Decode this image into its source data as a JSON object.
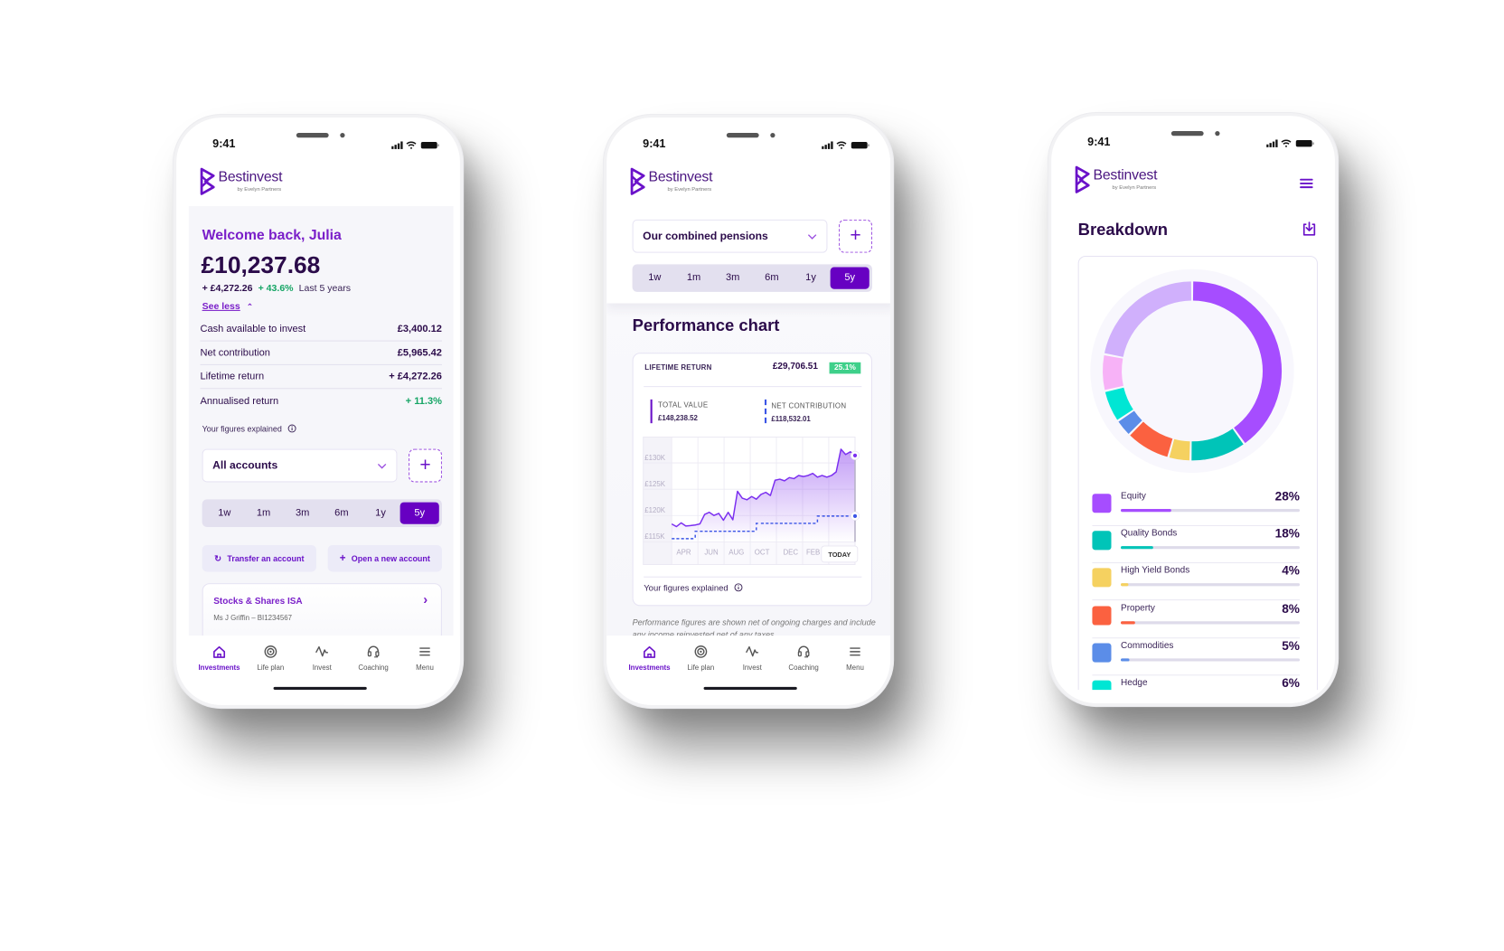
{
  "status": {
    "time": "9:41"
  },
  "brand": {
    "name": "Bestinvest",
    "tagline": "by Evelyn Partners"
  },
  "colors": {
    "brand_purple": "#6a12c9",
    "selected_period": "#6700c2",
    "text_dark": "#2b0b4a",
    "positive": "#16a565",
    "total_value_line": "#7b2ff0",
    "net_contribution_line": "#3b55e6"
  },
  "periods": [
    "1w",
    "1m",
    "3m",
    "6m",
    "1y",
    "5y"
  ],
  "selected_period": "5y",
  "nav": [
    {
      "label": "Investments",
      "icon": "home-icon",
      "active": true
    },
    {
      "label": "Life plan",
      "icon": "target-icon",
      "active": false
    },
    {
      "label": "Invest",
      "icon": "pulse-icon",
      "active": false
    },
    {
      "label": "Coaching",
      "icon": "headset-icon",
      "active": false
    },
    {
      "label": "Menu",
      "icon": "menu-icon",
      "active": false
    }
  ],
  "overview": {
    "welcome": "Welcome back, Julia",
    "total": "£10,237.68",
    "change_amount": "+ £4,272.26",
    "change_pct": "+ 43.6%",
    "change_period": "Last 5 years",
    "see_less": "See less",
    "rows": [
      {
        "label": "Cash available to invest",
        "value": "£3,400.12",
        "positive": false
      },
      {
        "label": "Net contribution",
        "value": "£5,965.42",
        "positive": false
      },
      {
        "label": "Lifetime return",
        "value": "+ £4,272.26",
        "positive": false
      },
      {
        "label": "Annualised return",
        "value": "+ 11.3%",
        "positive": true
      }
    ],
    "figures_explained": "Your figures explained",
    "account_select": "All accounts",
    "transfer_label": "Transfer an account",
    "open_label": "Open a new account",
    "account_card": {
      "title": "Stocks & Shares ISA",
      "subtitle": "Ms J Griffin – BI1234567"
    }
  },
  "performance": {
    "select": "Our combined pensions",
    "title": "Performance chart",
    "lifetime_label": "LIFETIME RETURN",
    "lifetime_value": "£29,706.51",
    "lifetime_pct": "25.1%",
    "total_value_label": "TOTAL VALUE",
    "total_value": "£148,238.52",
    "net_label": "NET CONTRIBUTION",
    "net_value": "£118,532.01",
    "figures_explained": "Your figures explained",
    "disclaimer": "Performance figures are shown net of ongoing charges and include any income reinvested net of any taxes"
  },
  "breakdown": {
    "title": "Breakdown"
  },
  "chart_data": [
    {
      "type": "area",
      "ylim": [
        115,
        135
      ],
      "y_ticks": [
        {
          "value": 130,
          "label": "£130K"
        },
        {
          "value": 125,
          "label": "£125K"
        },
        {
          "value": 120,
          "label": "£120K"
        },
        {
          "value": 115,
          "label": "£115K"
        }
      ],
      "x_labels": [
        "APR",
        "JUN",
        "AUG",
        "OCT",
        "DEC",
        "FEB",
        "TODAY"
      ],
      "grid": true,
      "series": [
        {
          "name": "TOTAL VALUE",
          "style": "solid",
          "color": "#7b2ff0",
          "values": [
            118.4,
            117.9,
            118.6,
            118.0,
            118.1,
            118.2,
            118.4,
            120.2,
            120.6,
            120.0,
            120.4,
            119.1,
            120.6,
            119.2,
            124.6,
            123.3,
            123.0,
            123.6,
            123.1,
            124.0,
            124.4,
            123.8,
            126.7,
            126.9,
            126.6,
            127.2,
            127.0,
            127.6,
            127.4,
            127.6,
            128.0,
            127.3,
            127.6,
            127.3,
            127.6,
            128.3,
            132.6,
            131.6,
            132.1,
            131.4
          ]
        },
        {
          "name": "NET CONTRIBUTION",
          "style": "dashed",
          "color": "#3b55e6",
          "values": [
            115.6,
            115.6,
            115.6,
            115.6,
            115.6,
            117.0,
            117.0,
            117.0,
            117.0,
            117.0,
            117.0,
            117.0,
            117.0,
            117.0,
            117.0,
            117.0,
            117.0,
            117.0,
            118.5,
            118.5,
            118.5,
            118.5,
            118.5,
            118.5,
            118.5,
            118.5,
            118.5,
            118.5,
            118.5,
            118.5,
            118.5,
            119.9,
            119.9,
            119.9,
            119.9,
            119.9,
            119.9,
            119.9,
            119.9,
            119.9
          ]
        }
      ]
    },
    {
      "type": "pie",
      "style": "donut",
      "segments": [
        {
          "color": "#a64dff",
          "share": 40.1
        },
        {
          "color": "#00c4b8",
          "share": 10.2
        },
        {
          "color": "#f5d160",
          "share": 4.0
        },
        {
          "color": "#fb6140",
          "share": 8.1
        },
        {
          "color": "#5b8de8",
          "share": 3.2
        },
        {
          "color": "#00e6d4",
          "share": 5.8
        },
        {
          "color": "#f7b2f7",
          "share": 6.6
        },
        {
          "color": "#d0b0fc",
          "share": 22.0
        }
      ],
      "legend": [
        {
          "label": "Equity",
          "value": 28,
          "display": "28%",
          "color": "#a64dff"
        },
        {
          "label": "Quality Bonds",
          "value": 18,
          "display": "18%",
          "color": "#00c4b8"
        },
        {
          "label": "High Yield Bonds",
          "value": 4,
          "display": "4%",
          "color": "#f5d160"
        },
        {
          "label": "Property",
          "value": 8,
          "display": "8%",
          "color": "#fb6140"
        },
        {
          "label": "Commodities",
          "value": 5,
          "display": "5%",
          "color": "#5b8de8"
        },
        {
          "label": "Hedge",
          "value": 6,
          "display": "6%",
          "color": "#00e6d4"
        }
      ]
    }
  ]
}
